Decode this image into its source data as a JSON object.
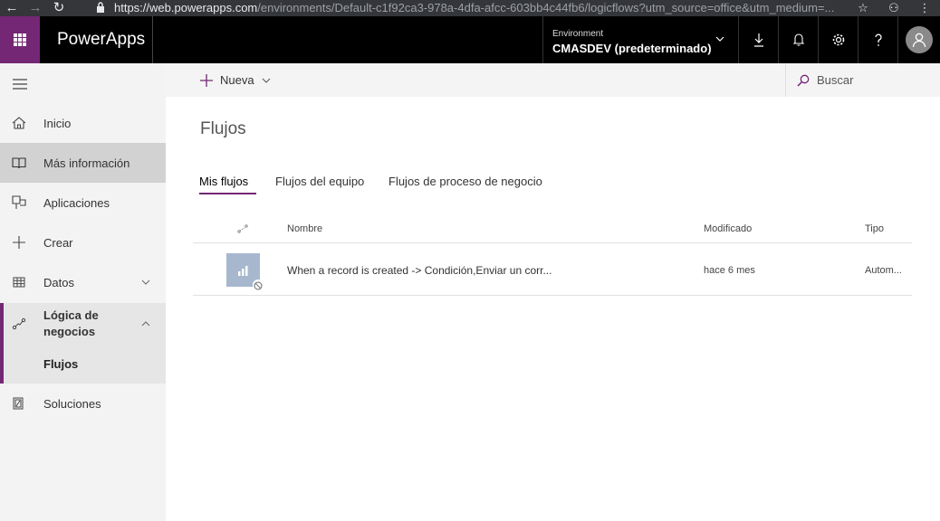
{
  "browser": {
    "url_host": "https://web.powerapps.com",
    "url_path": "/environments/Default-c1f92ca3-978a-4dfa-afcc-603bb4c44fb6/logicflows?utm_source=office&utm_medium=..."
  },
  "header": {
    "app_name": "PowerApps",
    "environment_label": "Environment",
    "environment_value": "CMASDEV (predeterminado)"
  },
  "sidebar": {
    "items": [
      {
        "label": "Inicio"
      },
      {
        "label": "Más información"
      },
      {
        "label": "Aplicaciones"
      },
      {
        "label": "Crear"
      },
      {
        "label": "Datos"
      },
      {
        "label": "Lógica de negocios"
      },
      {
        "label": "Flujos"
      },
      {
        "label": "Soluciones"
      }
    ]
  },
  "toolbar": {
    "new_label": "Nueva",
    "search_label": "Buscar"
  },
  "main": {
    "title": "Flujos",
    "tabs": [
      {
        "label": "Mis flujos"
      },
      {
        "label": "Flujos del equipo"
      },
      {
        "label": "Flujos de proceso de negocio"
      }
    ],
    "columns": {
      "name": "Nombre",
      "modified": "Modificado",
      "type": "Tipo"
    },
    "rows": [
      {
        "name": "When a record is created -> Condición,Enviar un corr...",
        "modified": "hace 6 mes",
        "type": "Autom..."
      }
    ]
  },
  "colors": {
    "accent": "#742774",
    "topbar": "#000000",
    "sidebar": "#f3f3f3",
    "flow_thumb": "#a7b8ce"
  }
}
